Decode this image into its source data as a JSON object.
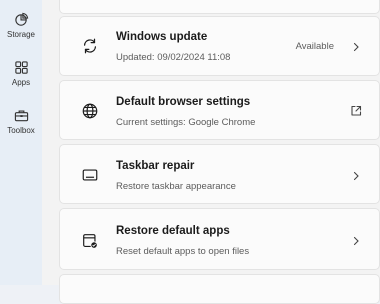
{
  "nav": {
    "items": [
      {
        "label": "Storage",
        "icon": "pie-chart-icon"
      },
      {
        "label": "Apps",
        "icon": "apps-grid-icon"
      },
      {
        "label": "Toolbox",
        "icon": "toolbox-icon"
      }
    ]
  },
  "cards": [
    {
      "title": "Windows update",
      "subtitle": "Updated: 09/02/2024 11:08",
      "status": "Available",
      "icon": "refresh-icon",
      "action_icon": "chevron-right-icon"
    },
    {
      "title": "Default browser settings",
      "subtitle": "Current settings: Google Chrome",
      "icon": "globe-icon",
      "action_icon": "external-link-icon"
    },
    {
      "title": "Taskbar repair",
      "subtitle": "Restore taskbar appearance",
      "icon": "taskbar-icon",
      "action_icon": "chevron-right-icon"
    },
    {
      "title": "Restore default apps",
      "subtitle": "Reset default apps to open files",
      "icon": "app-restore-icon",
      "action_icon": "chevron-right-icon"
    }
  ],
  "colors": {
    "nav_bg": "#e7eef6",
    "card_bg": "#fbfbfb",
    "text_primary": "#1b1b1b",
    "text_secondary": "#5c5c5c"
  }
}
